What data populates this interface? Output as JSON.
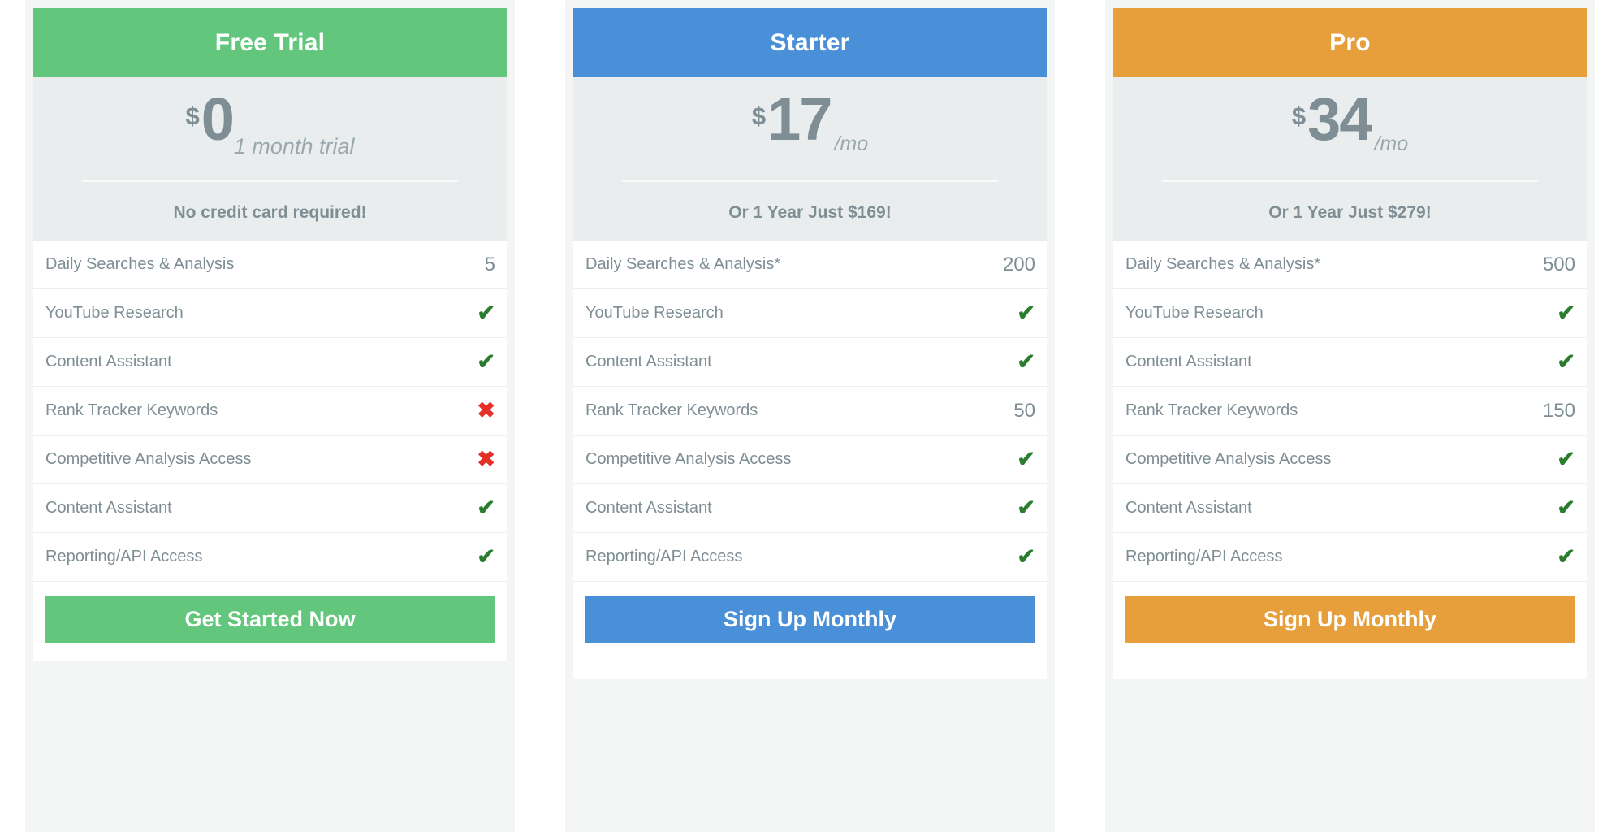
{
  "theme": {
    "page_background": "#ffffff",
    "card_background": "#f4f6f6",
    "price_background": "#e9edee",
    "muted_text": "#7e8e94",
    "check_color": "#2a7d2e",
    "cross_color": "#e53027"
  },
  "icons": {
    "check": "✔",
    "cross": "✖"
  },
  "plans": [
    {
      "name": "Free Trial",
      "accent": "#62c77d",
      "currency": "$",
      "amount": "0",
      "period": "1 month trial",
      "period_style": "trial",
      "note": "No credit card required!",
      "features": [
        {
          "label": "Daily Searches & Analysis",
          "value": "5",
          "kind": "text"
        },
        {
          "label": "YouTube Research",
          "value": "✔",
          "kind": "check"
        },
        {
          "label": "Content Assistant",
          "value": "✔",
          "kind": "check"
        },
        {
          "label": "Rank Tracker Keywords",
          "value": "✖",
          "kind": "cross"
        },
        {
          "label": "Competitive Analysis Access",
          "value": "✖",
          "kind": "cross"
        },
        {
          "label": "Content Assistant",
          "value": "✔",
          "kind": "check"
        },
        {
          "label": "Reporting/API Access",
          "value": "✔",
          "kind": "check"
        }
      ],
      "cta_label": "Get Started Now"
    },
    {
      "name": "Starter",
      "accent": "#4a90d9",
      "currency": "$",
      "amount": "17",
      "period": "/mo",
      "period_style": "mo",
      "note": "Or 1 Year Just $169!",
      "features": [
        {
          "label": "Daily Searches & Analysis*",
          "value": "200",
          "kind": "text"
        },
        {
          "label": "YouTube Research",
          "value": "✔",
          "kind": "check"
        },
        {
          "label": "Content Assistant",
          "value": "✔",
          "kind": "check"
        },
        {
          "label": "Rank Tracker Keywords",
          "value": "50",
          "kind": "text"
        },
        {
          "label": "Competitive Analysis Access",
          "value": "✔",
          "kind": "check"
        },
        {
          "label": "Content Assistant",
          "value": "✔",
          "kind": "check"
        },
        {
          "label": "Reporting/API Access",
          "value": "✔",
          "kind": "check"
        }
      ],
      "cta_label": "Sign Up Monthly"
    },
    {
      "name": "Pro",
      "accent": "#e79f3c",
      "currency": "$",
      "amount": "34",
      "period": "/mo",
      "period_style": "mo",
      "note": "Or 1 Year Just $279!",
      "features": [
        {
          "label": "Daily Searches & Analysis*",
          "value": "500",
          "kind": "text"
        },
        {
          "label": "YouTube Research",
          "value": "✔",
          "kind": "check"
        },
        {
          "label": "Content Assistant",
          "value": "✔",
          "kind": "check"
        },
        {
          "label": "Rank Tracker Keywords",
          "value": "150",
          "kind": "text"
        },
        {
          "label": "Competitive Analysis Access",
          "value": "✔",
          "kind": "check"
        },
        {
          "label": "Content Assistant",
          "value": "✔",
          "kind": "check"
        },
        {
          "label": "Reporting/API Access",
          "value": "✔",
          "kind": "check"
        }
      ],
      "cta_label": "Sign Up Monthly"
    }
  ]
}
